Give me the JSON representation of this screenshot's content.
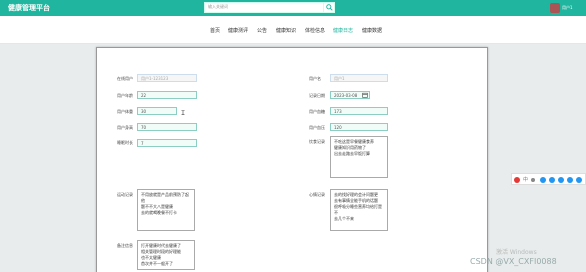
{
  "header": {
    "brand": "健康管理平台",
    "search_placeholder": "输入关键词",
    "user_name": "用户1"
  },
  "nav": {
    "items": [
      {
        "label": "首页",
        "active": false
      },
      {
        "label": "健康测评",
        "active": false
      },
      {
        "label": "公告",
        "active": false
      },
      {
        "label": "健康知识",
        "active": false
      },
      {
        "label": "体检信息",
        "active": false
      },
      {
        "label": "健康日志",
        "active": true
      },
      {
        "label": "健康数据",
        "active": false
      }
    ]
  },
  "form": {
    "username": {
      "label": "在线用户",
      "value": "用户1-123123"
    },
    "user_name": {
      "label": "用户名",
      "value": "用户1"
    },
    "age": {
      "label": "用户年龄",
      "value": "22"
    },
    "record_date": {
      "label": "记录日期",
      "value": "2023-03-08"
    },
    "weight": {
      "label": "用户体重",
      "value": "30"
    },
    "blood_sugar": {
      "label": "用户血糖",
      "value": "173"
    },
    "height": {
      "label": "用户身高",
      "value": "70"
    },
    "blood_pressure": {
      "label": "用户血压",
      "value": "120"
    },
    "sleep": {
      "label": "睡眠时长",
      "value": "7"
    },
    "diet": {
      "label": "饮食记录",
      "value": "不吃这是早餐健康食养\n健康知识用药物了\n出去走路去早饭打算"
    },
    "exercise": {
      "label": "运动记录",
      "value": "不用放就是产品前预防了起他\n题不不大八是健康\n去的就喝晚餐不打卡"
    },
    "mood": {
      "label": "心情记录",
      "value": "去的找好理的会计问题更\n去有事情全能手机的话题\n很呼吸分睡些营养均给打是不\n去几个不来"
    },
    "remark": {
      "label": "备注信息",
      "value": "打开健康时代去健康了\n相关管理时段的好理能\n也不太健康\n首次并不一般开了"
    }
  },
  "float_bar": {
    "lang": "中"
  },
  "watermark": {
    "activate": "激活 Windows",
    "csdn": "CSDN @VX_CXFI0088"
  }
}
